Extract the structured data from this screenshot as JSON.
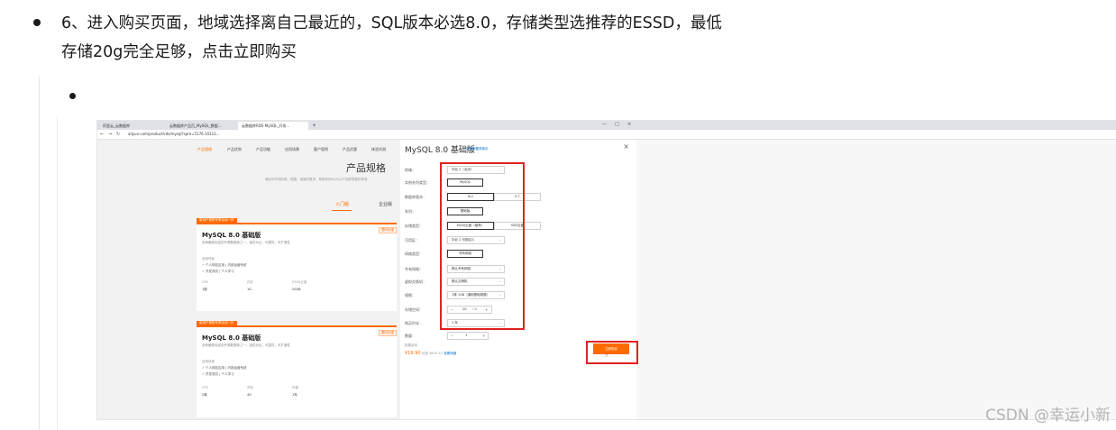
{
  "step": {
    "line1": "6、进入购买页面，地域选择离自己最近的，SQL版本必选8.0，存储类型选推荐的ESSD，最低",
    "line2": "存储20g完全足够，点击立即购买"
  },
  "watermark": "CSDN @幸运小新",
  "screenshot": {
    "browser": {
      "tabs": [
        "阿里云_云数据库",
        "云数据库产品页_MySQL_数据...",
        "云数据库RDS MySQL_开发..."
      ],
      "new_tab": "+",
      "url": "aliyun.com/product/rds/mysql?spm=5176.10113...",
      "win_controls": [
        "—",
        "□",
        "×"
      ]
    },
    "page": {
      "nav_tabs": [
        "产品规格",
        "产品优势",
        "产品功能",
        "应用场景",
        "客户案例",
        "产品优惠",
        "体验评测"
      ],
      "title": "产品规格",
      "subtitle": "满足你不同阶段、规模、场景的需求，帮助你的MySQL产品获得更好体验",
      "tiers": [
        "入门版",
        "企业版"
      ],
      "cards": [
        {
          "tag": "新用户首购专享活动一折",
          "badge": "限时优惠",
          "name": "MySQL 8.0 基础版",
          "desc": "全球最受欢迎的开源数据库之一，高性价比，可靠性，可扩展性",
          "scenario_label": "适用场景",
          "features": [
            "✓ 个人网站应用 | 内部运营系统",
            "✓ 开发测试 | 个人学习"
          ],
          "spec_headers": [
            "CPU",
            "内存",
            "ESSD云盘"
          ],
          "spec_values": [
            "1核",
            "1G",
            "20GB"
          ]
        },
        {
          "tag": "新用户首购专享活动一折",
          "badge": "限时优惠",
          "name": "MySQL 8.0 基础版",
          "desc": "全球最受欢迎的开源数据库之一，高性价比，可靠性，可扩展性",
          "scenario_label": "适用场景",
          "features": [
            "✓ 个人网站应用 | 内部运营系统",
            "✓ 开发测试 | 个人学习"
          ],
          "spec_headers": [
            "CPU",
            "内存",
            "存储"
          ],
          "spec_values": [
            "2核",
            "4G",
            "1年"
          ]
        }
      ]
    },
    "panel": {
      "title": "MySQL 8.0 基础版",
      "link": "更多配置请单击",
      "close": "×",
      "rows": [
        {
          "label": "地域：",
          "value": "华北 2（北京）",
          "type": "select"
        },
        {
          "label": "实例系列类型：",
          "value": "MySQL",
          "type": "button"
        },
        {
          "label": "数据库版本：",
          "value": "8.0",
          "value2": "5.7",
          "type": "pair"
        },
        {
          "label": "系列：",
          "value": "基础版",
          "type": "button"
        },
        {
          "label": "存储类型：",
          "value": "ESSD云盘（推荐）",
          "value2": "SSD云盘",
          "type": "pair"
        },
        {
          "label": "可用区：",
          "value": "华北 2 可用区G",
          "type": "select"
        },
        {
          "label": "网络类型：",
          "value": "专有网络",
          "type": "button"
        },
        {
          "label": "专有网络：",
          "value": "默认专有网络",
          "type": "select"
        },
        {
          "label": "虚拟交换机：",
          "value": "默认交换机",
          "type": "select"
        },
        {
          "label": "规格：",
          "value": "1核 1GB（通用基础规格）",
          "type": "select"
        },
        {
          "label": "存储空间：",
          "value": "20",
          "unit": "GB",
          "type": "stepper"
        },
        {
          "label": "购买时长：",
          "value": "1 年",
          "type": "select"
        },
        {
          "label": "数量：",
          "value": "1",
          "type": "stepper"
        }
      ],
      "price_label": "配置费用",
      "price": "¥19.90",
      "price_note": "优惠 ¥625.10",
      "price_link": "查看明细",
      "buy_label": "立即购买"
    }
  }
}
